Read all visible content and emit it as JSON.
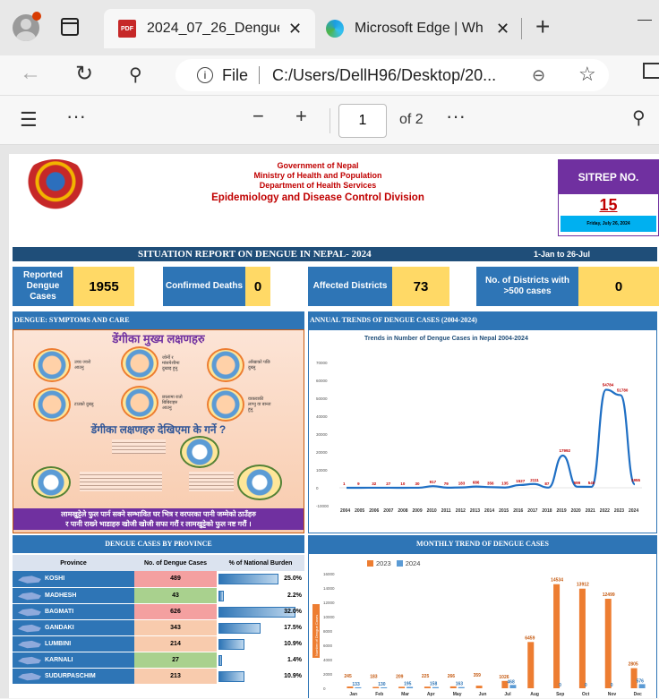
{
  "browser": {
    "tab_active_title": "2024_07_26_Dengue",
    "tab_inactive_title": "Microsoft Edge | Wh",
    "url_scheme_label": "File",
    "url": "C:/Users/DellH96/Desktop/20...",
    "pdf_icon_text": "PDF"
  },
  "pdf_toolbar": {
    "page_current": "1",
    "page_total_label": "of 2"
  },
  "report": {
    "gov_line1": "Government of Nepal",
    "gov_line2": "Ministry of Health and Population",
    "gov_line3": "Department of Health Services",
    "gov_line4": "Epidemiology and Disease Control Division",
    "sitrep_label": "SITREP NO.",
    "sitrep_no": "15",
    "sitrep_date": "Friday, July 26, 2024",
    "main_title": "SITUATION REPORT ON DENGUE IN NEPAL- 2024",
    "date_range": "1-Jan   to   26-Jul",
    "kpis": {
      "reported_label": "Reported Dengue Cases",
      "reported_value": "1955",
      "deaths_label": "Confirmed Deaths",
      "deaths_value": "0",
      "districts_label": "Affected Districts",
      "districts_value": "73",
      "over500_label": "No. of Districts with >500 cases",
      "over500_value": "0"
    },
    "symptoms": {
      "header": "DENGUE: SYMPTOMS AND CARE",
      "heading": "डेंगीका मुख्य लक्षणहरु",
      "items": [
        "उच्च ज्वरो आउनु",
        "जोर्नी र मांसपेशीमा दुखाइ हुनु",
        "आँखाको पछि दुख्नु",
        "टाउको दुख्नु",
        "छालामा रातो बिबिराहरु आउनु",
        "वाकवाकी लाग्नु वा बान्ता हुनु"
      ],
      "what_to_do": "डेंगीका लक्षणहरु देखिएमा के गर्ने ?",
      "footer_line1": "लामखुट्टेले फुल पार्न सक्ने सम्भावित घर भित्र र वरपरका पानी जम्मेको ठाउँहरु",
      "footer_line2": "र पानी राख्ने भाडाहरु खोजी खोजी सफा गरौं र लामखुट्टेको फुल नष्ट गरौं ।"
    },
    "annual": {
      "header": "ANNUAL TRENDS OF DENGUE CASES (2004-2024)",
      "title": "Trends in Number of Dengue Cases in Nepal 2004-2024",
      "y_ticks": [
        "70000",
        "60000",
        "50000",
        "40000",
        "30000",
        "20000",
        "10000",
        "0",
        "-10000"
      ]
    },
    "province": {
      "header": "DENGUE CASES BY PROVINCE",
      "col_province": "Province",
      "col_cases": "No. of Dengue Cases",
      "col_burden": "% of National Burden",
      "rows": [
        {
          "name": "KOSHI",
          "cases": "489",
          "burden": "25.0%",
          "pct": 25.0,
          "color": "#f4a0a0"
        },
        {
          "name": "MADHESH",
          "cases": "43",
          "burden": "2.2%",
          "pct": 2.2,
          "color": "#a9d18e"
        },
        {
          "name": "BAGMATI",
          "cases": "626",
          "burden": "32.0%",
          "pct": 32.0,
          "color": "#f4a0a0"
        },
        {
          "name": "GANDAKI",
          "cases": "343",
          "burden": "17.5%",
          "pct": 17.5,
          "color": "#f8cbad"
        },
        {
          "name": "LUMBINI",
          "cases": "214",
          "burden": "10.9%",
          "pct": 10.9,
          "color": "#f8cbad"
        },
        {
          "name": "KARNALI",
          "cases": "27",
          "burden": "1.4%",
          "pct": 1.4,
          "color": "#a9d18e"
        },
        {
          "name": "SUDURPASCHIM",
          "cases": "213",
          "burden": "10.9%",
          "pct": 10.9,
          "color": "#f8cbad"
        }
      ]
    },
    "monthly": {
      "header": "MONTHLY TREND OF DENGUE CASES",
      "y_ticks": [
        "16000",
        "14000",
        "12000",
        "10000",
        "8000",
        "6000",
        "4000",
        "2000",
        "0"
      ],
      "y_axis_title": "Number of Dengue Cases"
    }
  },
  "chart_data": [
    {
      "type": "line",
      "title": "Trends in Number of Dengue Cases in Nepal 2004-2024",
      "x": [
        "2004",
        "2005",
        "2006",
        "2007",
        "2008",
        "2009",
        "2010",
        "2011",
        "2012",
        "2013",
        "2014",
        "2015",
        "2016",
        "2017",
        "2018",
        "2019",
        "2020",
        "2021",
        "2022",
        "2023",
        "2024"
      ],
      "series": [
        {
          "name": "",
          "values": [
            1,
            9,
            32,
            27,
            10,
            30,
            917,
            79,
            183,
            686,
            356,
            135,
            1527,
            2111,
            87,
            17992,
            599,
            540,
            54784,
            51780,
            1955
          ]
        }
      ],
      "value_labels": [
        "1",
        "9",
        "32",
        "27",
        "10",
        "30",
        "917",
        "79",
        "183",
        "686",
        "356",
        "135",
        "1527",
        "2111",
        "87",
        "17992",
        "599",
        "540",
        "54784",
        "51780",
        "1955"
      ],
      "ylim": [
        -10000,
        70000
      ]
    },
    {
      "type": "bar",
      "categories": [
        "Jan",
        "Feb",
        "Mar",
        "Apr",
        "May",
        "Jun",
        "Jul",
        "Aug",
        "Sep",
        "Oct",
        "Nov",
        "Dec"
      ],
      "series": [
        {
          "name": "2023",
          "values": [
            245,
            183,
            209,
            225,
            266,
            359,
            1026,
            6459,
            14534,
            13912,
            12499,
            2805
          ],
          "labels": [
            "245",
            "183",
            "209",
            "225",
            "266",
            "359",
            "1026",
            "6459",
            "14534",
            "13912",
            "12499",
            "2805"
          ]
        },
        {
          "name": "2024",
          "values": [
            133,
            130,
            195,
            158,
            163,
            0,
            468,
            0,
            0,
            0,
            0,
            576
          ],
          "labels": [
            "133",
            "130",
            "195",
            "158",
            "163",
            "",
            "468",
            "",
            "0",
            "0",
            "0",
            "576"
          ]
        }
      ],
      "ylim": [
        0,
        16000
      ],
      "legend": "top-left"
    }
  ]
}
